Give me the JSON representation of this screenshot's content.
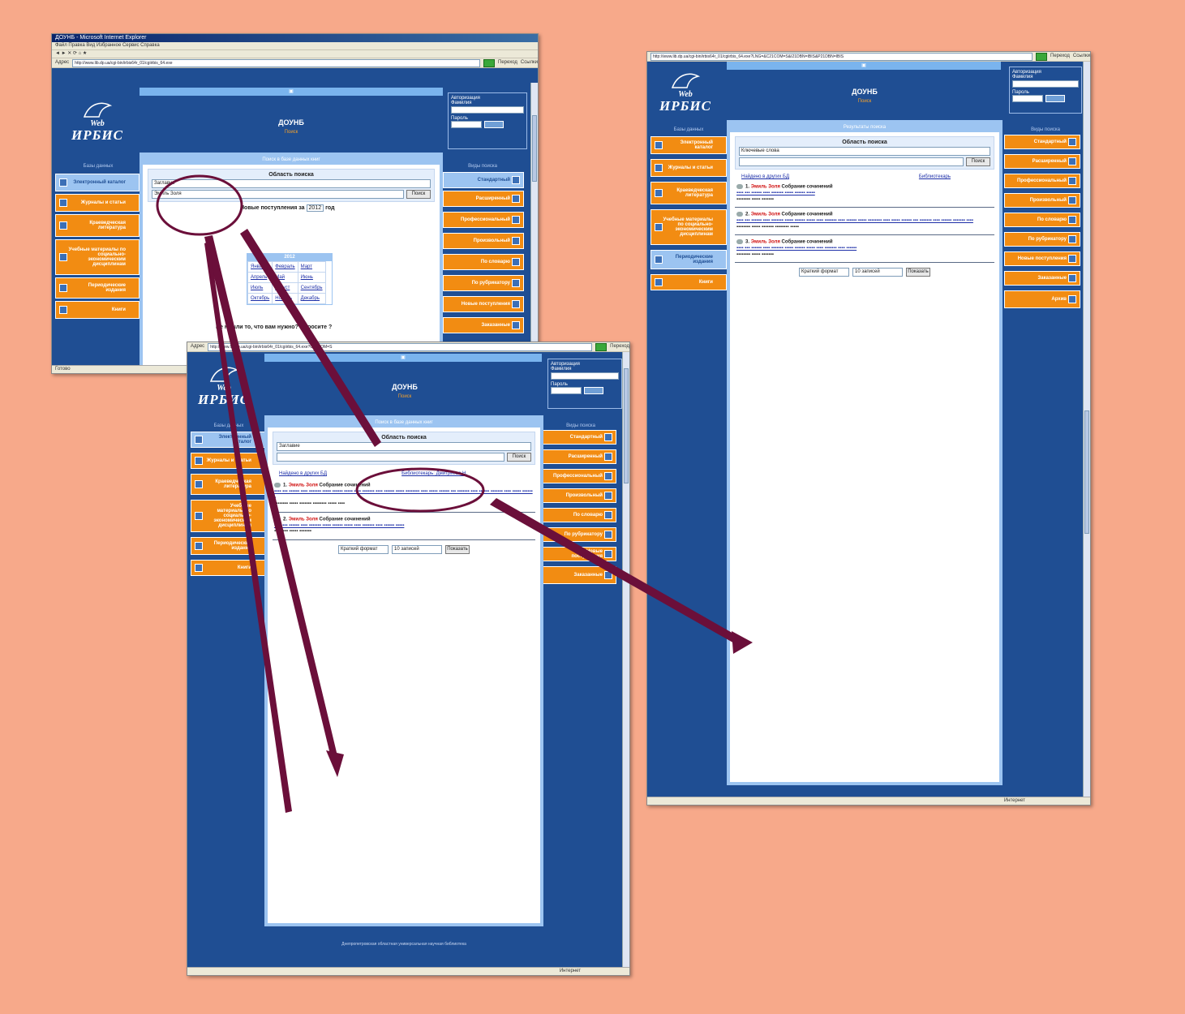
{
  "colors": {
    "background": "#f7a98a",
    "site_blue": "#1f4e93",
    "menu_orange": "#f28c12",
    "light_blue": "#9cc4f1",
    "arrow": "#6b0f3a"
  },
  "brand": {
    "line1": "Web",
    "line2": "ИРБИС"
  },
  "site": {
    "title": "ДОУНБ",
    "subtitle": "Поиск"
  },
  "win1": {
    "title": "ДОУНБ - Microsoft Internet Explorer",
    "menu": "Файл  Правка  Вид  Избранное  Сервис  Справка",
    "address_label": "Адрес",
    "address": "http://www.lib.dp.ua/cgi-bin/irbis64r_01/cgiirbis_64.exe",
    "go_label": "Переход",
    "links_label": "Ссылки",
    "login_title": "Авторизация",
    "login_label": "Фамилия",
    "password_label": "Пароль",
    "login_btn": "Войти",
    "left_header": "Базы данных",
    "right_header": "Виды поиска",
    "left_menu": [
      "Электронный каталог",
      "Журналы и статьи",
      "Краеведческая литература",
      "Учебные материалы по социально-экономическим дисциплинам",
      "Периодические издания",
      "Книги"
    ],
    "right_menu": [
      "Стандартный",
      "Расширенный",
      "Профессиональный",
      "Произвольный",
      "По словарю",
      "По рубрикатору",
      "Новые поступления",
      "Заказанные"
    ],
    "panel_header": "Поиск в базе данных книг",
    "search_title": "Область поиска",
    "search_select": "Заглавие",
    "search_value": "Эмиль Золя",
    "search_btn": "Поиск",
    "calendar_label": "Новые поступления за",
    "calendar_year": "2012",
    "calendar_suffix": "год",
    "calendar_head": "2012",
    "calendar_cells": [
      "Январь",
      "Февраль",
      "Март",
      "Апрель",
      "Май",
      "Июнь",
      "Июль",
      "Август",
      "Сентябрь",
      "Октябрь",
      "Ноябрь",
      "Декабрь"
    ],
    "question": "Не нашли то, что вам нужно? Спросите ?",
    "status": "Готово"
  },
  "win2": {
    "address_label": "Адрес",
    "address": "http://www.lib.dp.ua/cgi-bin/irbis64r_01/cgiirbis_64.exe?C21COM=S",
    "go_label": "Переход",
    "login_title": "Авторизация",
    "login_label": "Фамилия",
    "password_label": "Пароль",
    "login_btn": "Войти",
    "left_header": "Базы данных",
    "right_header": "Виды поиска",
    "left_menu": [
      "Электронный каталог",
      "Журналы и статьи",
      "Краеведческая литература",
      "Учебные материалы по социально-экономическим дисциплинам",
      "Периодические издания",
      "Книги"
    ],
    "right_menu": [
      "Стандартный",
      "Расширенный",
      "Профессиональный",
      "Произвольный",
      "По словарю",
      "По рубрикатору",
      "Новые поступления",
      "Заказанные"
    ],
    "panel_header": "Поиск в базе данных книг",
    "search_title": "Область поиска",
    "search_select": "Заглавие",
    "search_btn": "Поиск",
    "link_left": "Найдено в других БД",
    "link_center": "Библиотекарь: Дмитриева Н.",
    "record1_author": "Эмиль Золя",
    "record1_title": "Собрание сочинений",
    "record2_author": "Эмиль Золя",
    "record2_title": "Собрание сочинений",
    "footer": "Днепропетровская областная универсальная научная библиотека",
    "format_select": "Краткий формат",
    "count_select": "10 записей",
    "show_btn": "Показать",
    "status": "Интернет"
  },
  "win3": {
    "address": "http://www.lib.dp.ua/cgi-bin/irbis64r_01/cgiirbis_64.exe?LNG=&C21COM=S&I21DBN=IBIS&P21DBN=IBIS",
    "go_label": "Переход",
    "links_label": "Ссылки",
    "login_title": "Авторизация",
    "login_label": "Фамилия",
    "password_label": "Пароль",
    "login_btn": "Войти",
    "left_header": "Базы данных",
    "right_header": "Виды поиска",
    "left_menu": [
      "Электронный каталог",
      "Журналы и статьи",
      "Краеведческая литература",
      "Учебные материалы по социально-экономическим дисциплинам",
      "Периодические издания",
      "Книги"
    ],
    "right_menu": [
      "Стандартный",
      "Расширенный",
      "Профессиональный",
      "Произвольный",
      "По словарю",
      "По рубрикатору",
      "Новые поступления",
      "Заказанные",
      "Архив"
    ],
    "panel_header": "Результаты поиска",
    "search_title": "Область поиска",
    "search_select": "Ключевые слова",
    "search_btn": "Поиск",
    "link_left": "Найдено в других БД",
    "link_center": "Библиотекарь",
    "record1_author": "Эмиль Золя",
    "record1_title": "Собрание сочинений",
    "record2_author": "Эмиль Золя",
    "record2_title": "Собрание сочинений",
    "record3_author": "Эмиль Золя",
    "record3_title": "Собрание сочинений",
    "format_select": "Краткий формат",
    "count_select": "10 записей",
    "show_btn": "Показать",
    "status": "Интернет"
  }
}
